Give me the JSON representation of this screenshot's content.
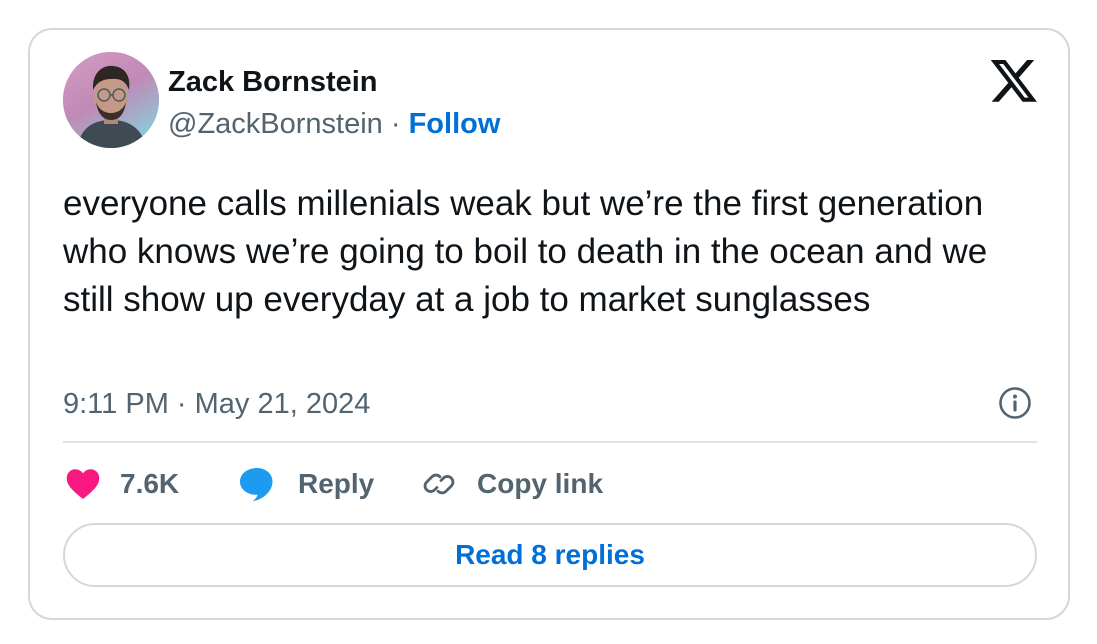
{
  "author": {
    "name": "Zack Bornstein",
    "handle": "@ZackBornstein",
    "separator": "·",
    "follow_label": "Follow"
  },
  "tweet": {
    "text": "everyone calls millenials weak but we’re the first generation who knows we’re going to boil to death in the ocean and we still show up everyday at a job to market sunglasses",
    "timestamp": "9:11 PM · May 21, 2024"
  },
  "actions": {
    "likes_count": "7.6K",
    "reply_label": "Reply",
    "copy_link_label": "Copy link",
    "read_replies_label": "Read 8 replies"
  },
  "icons": {
    "logo": "x-logo-icon",
    "info": "info-icon",
    "like": "heart-icon",
    "reply": "speech-bubble-icon",
    "copy": "link-icon"
  },
  "colors": {
    "follow_blue": "#006fd6",
    "heart_pink": "#f91880",
    "reply_blue": "#1d9bf0",
    "muted_gray": "#536471",
    "border": "#cfd9de"
  }
}
